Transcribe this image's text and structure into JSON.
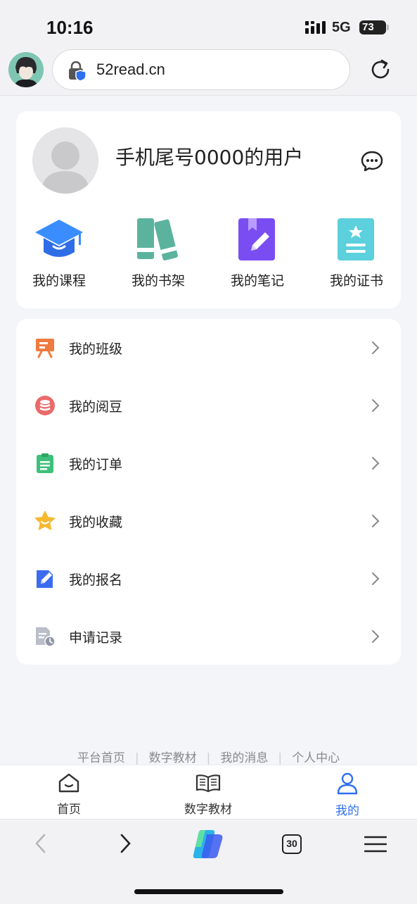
{
  "status": {
    "time": "10:16",
    "network": "5G",
    "battery": "73"
  },
  "browser": {
    "url": "52read.cn",
    "tab_count": "30"
  },
  "profile": {
    "username": "手机尾号0000的用户"
  },
  "quick_links": [
    {
      "label": "我的课程",
      "icon": "graduation-cap-icon"
    },
    {
      "label": "我的书架",
      "icon": "bookshelf-icon"
    },
    {
      "label": "我的笔记",
      "icon": "notebook-pen-icon"
    },
    {
      "label": "我的证书",
      "icon": "certificate-icon"
    }
  ],
  "menu": [
    {
      "label": "我的班级",
      "icon": "classroom-icon",
      "color": "#f07b3f"
    },
    {
      "label": "我的阅豆",
      "icon": "coins-icon",
      "color": "#ea6a6a"
    },
    {
      "label": "我的订单",
      "icon": "clipboard-icon",
      "color": "#3fc07a"
    },
    {
      "label": "我的收藏",
      "icon": "star-icon",
      "color": "#f5b82e"
    },
    {
      "label": "我的报名",
      "icon": "signup-icon",
      "color": "#3b6cf0"
    },
    {
      "label": "申请记录",
      "icon": "record-icon",
      "color": "#a7adbb"
    }
  ],
  "footer_links": [
    "平台首页",
    "数字教材",
    "我的消息",
    "个人中心"
  ],
  "app_nav": [
    {
      "label": "首页",
      "icon": "home-icon",
      "active": false
    },
    {
      "label": "数字教材",
      "icon": "open-book-icon",
      "active": false
    },
    {
      "label": "我的",
      "icon": "user-icon",
      "active": true
    }
  ],
  "colors": {
    "accent": "#2e6ff0",
    "background": "#f4f5f9"
  }
}
